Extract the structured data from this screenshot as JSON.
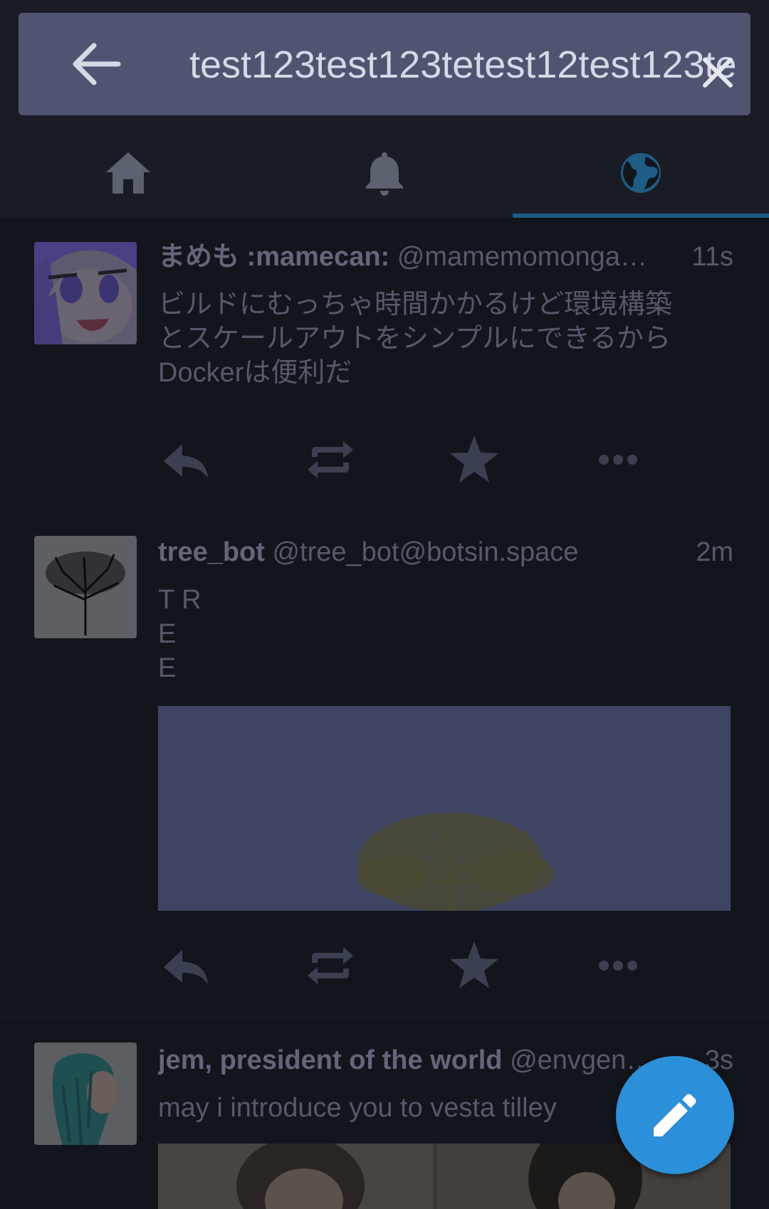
{
  "search": {
    "value": "test123test123tetest12test123te",
    "back_icon": "arrow-left-icon",
    "clear_icon": "close-icon"
  },
  "tabs": [
    {
      "name": "home",
      "icon": "home-icon"
    },
    {
      "name": "notifications",
      "icon": "bell-icon"
    },
    {
      "name": "federated",
      "icon": "globe-icon",
      "active": true
    }
  ],
  "statuses": [
    {
      "display_name": "まめも :mamecan:",
      "acct": "@mamemomonga…",
      "time": "11s",
      "content": "ビルドにむっちゃ時間かかるけど環境構築\nとスケールアウトをシンプルにできるから\nDockerは便利だ"
    },
    {
      "display_name": "tree_bot",
      "acct": "@tree_bot@botsin.space",
      "time": "2m",
      "content": "T R\nE\nE"
    },
    {
      "display_name": "jem, president of the world",
      "acct": "@envgen…",
      "time": "3s",
      "content": "may i introduce you to vesta tilley"
    }
  ],
  "colors": {
    "accent": "#2b90d9",
    "search_bg": "#4f5471",
    "background": "#13151c"
  },
  "compose_icon": "pencil-icon"
}
